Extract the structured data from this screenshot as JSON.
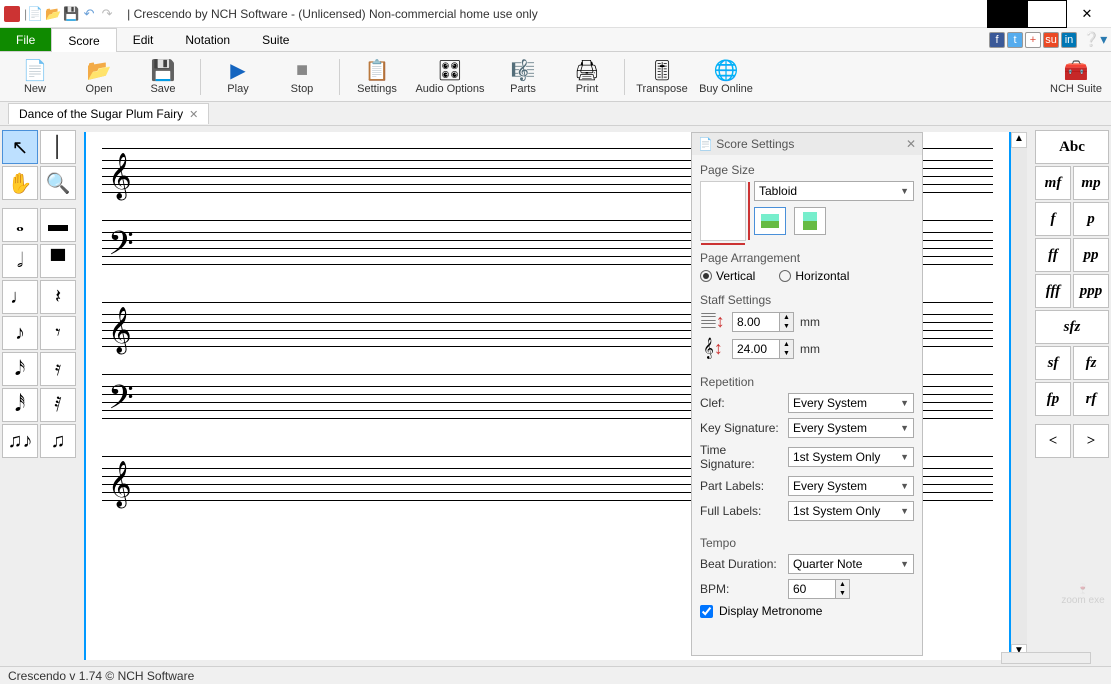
{
  "title": "|  Crescendo by NCH Software - (Unlicensed) Non-commercial home use only",
  "menus": {
    "file": "File",
    "score": "Score",
    "edit": "Edit",
    "notation": "Notation",
    "suite": "Suite"
  },
  "toolbar": {
    "new": "New",
    "open": "Open",
    "save": "Save",
    "play": "Play",
    "stop": "Stop",
    "settings": "Settings",
    "audio_options": "Audio Options",
    "parts": "Parts",
    "print": "Print",
    "transpose": "Transpose",
    "buy_online": "Buy Online",
    "nch_suite": "NCH Suite"
  },
  "document_tab": "Dance of the Sugar Plum Fairy",
  "right_palette": [
    "Abc",
    "mf",
    "mp",
    "f",
    "p",
    "ff",
    "pp",
    "fff",
    "ppp",
    "sfz",
    "sf",
    "fz",
    "fp",
    "rf",
    "<",
    ">"
  ],
  "settings_panel": {
    "title": "Score Settings",
    "page_size": {
      "label": "Page Size",
      "value": "Tabloid"
    },
    "page_arrangement": {
      "label": "Page Arrangement",
      "vertical": "Vertical",
      "horizontal": "Horizontal",
      "selected": "vertical"
    },
    "staff_settings": {
      "label": "Staff Settings",
      "treble": "8.00",
      "bass": "24.00",
      "unit": "mm"
    },
    "repetition": {
      "label": "Repetition",
      "clef": {
        "label": "Clef:",
        "value": "Every System"
      },
      "key_sig": {
        "label": "Key Signature:",
        "value": "Every System"
      },
      "time_sig": {
        "label": "Time Signature:",
        "value": "1st System Only"
      },
      "part_labels": {
        "label": "Part Labels:",
        "value": "Every System"
      },
      "full_labels": {
        "label": "Full Labels:",
        "value": "1st System Only"
      }
    },
    "tempo": {
      "label": "Tempo",
      "beat_dur_label": "Beat Duration:",
      "beat_dur": "Quarter Note",
      "bpm_label": "BPM:",
      "bpm": "60",
      "metronome": "Display Metronome"
    }
  },
  "status": "Crescendo v 1.74 © NCH Software"
}
